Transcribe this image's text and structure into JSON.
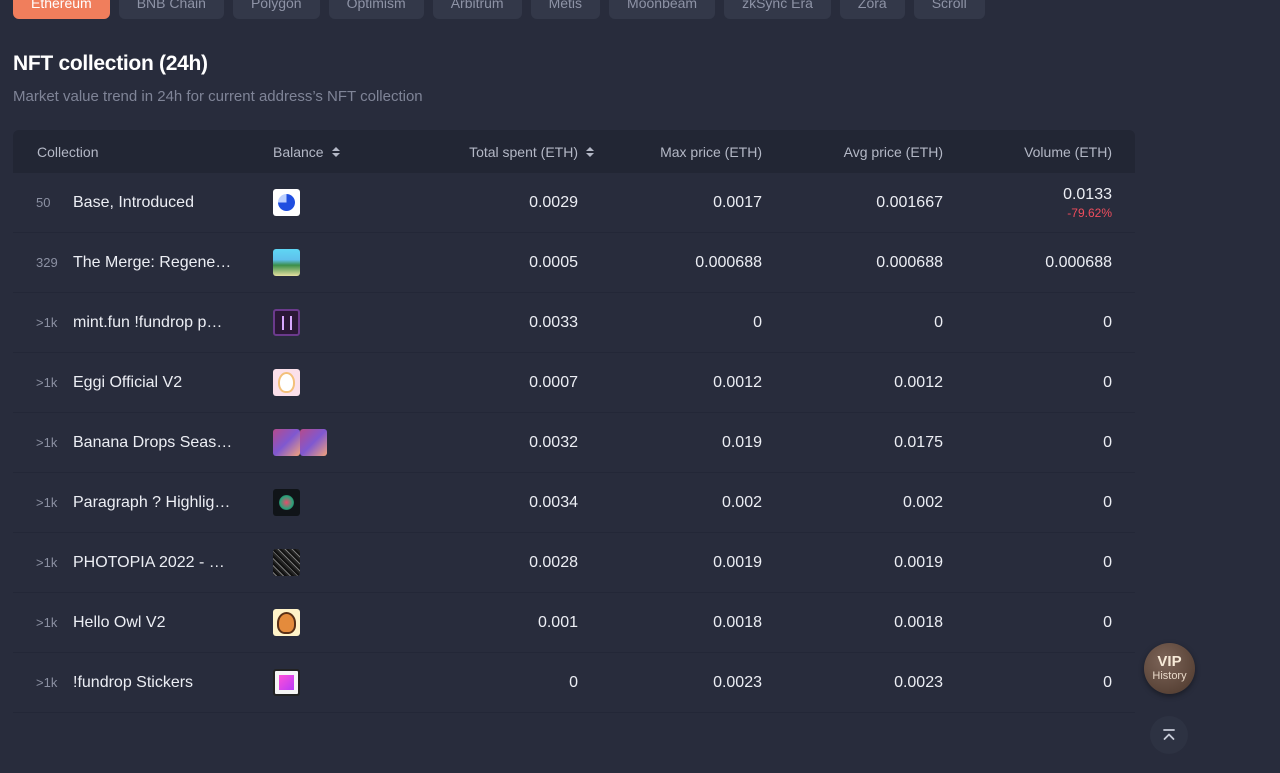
{
  "chain_tabs": [
    {
      "label": "Ethereum",
      "active": true
    },
    {
      "label": "BNB Chain",
      "active": false
    },
    {
      "label": "Polygon",
      "active": false
    },
    {
      "label": "Optimism",
      "active": false
    },
    {
      "label": "Arbitrum",
      "active": false
    },
    {
      "label": "Metis",
      "active": false
    },
    {
      "label": "Moonbeam",
      "active": false
    },
    {
      "label": "zkSync Era",
      "active": false
    },
    {
      "label": "Zora",
      "active": false
    },
    {
      "label": "Scroll",
      "active": false
    }
  ],
  "section": {
    "title": "NFT collection (24h)",
    "subtitle": "Market value trend in 24h for current address’s NFT collection"
  },
  "table": {
    "headers": {
      "collection": "Collection",
      "balance": "Balance",
      "total_spent": "Total spent (ETH)",
      "max_price": "Max price (ETH)",
      "avg_price": "Avg price (ETH)",
      "volume": "Volume (ETH)"
    },
    "rows": [
      {
        "rank": "50",
        "name": "Base, Introduced",
        "thumbs": [
          "base-thumb"
        ],
        "total_spent": "0.0029",
        "max_price": "0.0017",
        "avg_price": "0.001667",
        "volume": "0.0133",
        "volume_change": "-79.62%"
      },
      {
        "rank": "329",
        "name": "The Merge: Regene…",
        "thumbs": [
          "merge-thumb"
        ],
        "total_spent": "0.0005",
        "max_price": "0.000688",
        "avg_price": "0.000688",
        "volume": "0.000688",
        "volume_change": ""
      },
      {
        "rank": ">1k",
        "name": "mint.fun !fundrop p…",
        "thumbs": [
          "mint-thumb"
        ],
        "total_spent": "0.0033",
        "max_price": "0",
        "avg_price": "0",
        "volume": "0",
        "volume_change": ""
      },
      {
        "rank": ">1k",
        "name": "Eggi Official V2",
        "thumbs": [
          "eggi-thumb"
        ],
        "total_spent": "0.0007",
        "max_price": "0.0012",
        "avg_price": "0.0012",
        "volume": "0",
        "volume_change": ""
      },
      {
        "rank": ">1k",
        "name": "Banana Drops Seas…",
        "thumbs": [
          "banana-thumb",
          "banana-thumb"
        ],
        "total_spent": "0.0032",
        "max_price": "0.019",
        "avg_price": "0.0175",
        "volume": "0",
        "volume_change": ""
      },
      {
        "rank": ">1k",
        "name": "Paragraph ? Highlig…",
        "thumbs": [
          "paragraph-thumb"
        ],
        "total_spent": "0.0034",
        "max_price": "0.002",
        "avg_price": "0.002",
        "volume": "0",
        "volume_change": ""
      },
      {
        "rank": ">1k",
        "name": "PHOTOPIA 2022 - …",
        "thumbs": [
          "photopia-thumb"
        ],
        "total_spent": "0.0028",
        "max_price": "0.0019",
        "avg_price": "0.0019",
        "volume": "0",
        "volume_change": ""
      },
      {
        "rank": ">1k",
        "name": "Hello Owl V2",
        "thumbs": [
          "owl-thumb"
        ],
        "total_spent": "0.001",
        "max_price": "0.0018",
        "avg_price": "0.0018",
        "volume": "0",
        "volume_change": ""
      },
      {
        "rank": ">1k",
        "name": "!fundrop Stickers",
        "thumbs": [
          "fundrop-thumb"
        ],
        "total_spent": "0",
        "max_price": "0.0023",
        "avg_price": "0.0023",
        "volume": "0",
        "volume_change": ""
      }
    ]
  },
  "floating": {
    "vip_label": "VIP",
    "history_label": "History",
    "back_to_top_icon": "double-chevron-up-icon"
  },
  "colors": {
    "background": "#282c3c",
    "accent": "#f07e5c",
    "negative": "#ef4d5d"
  }
}
